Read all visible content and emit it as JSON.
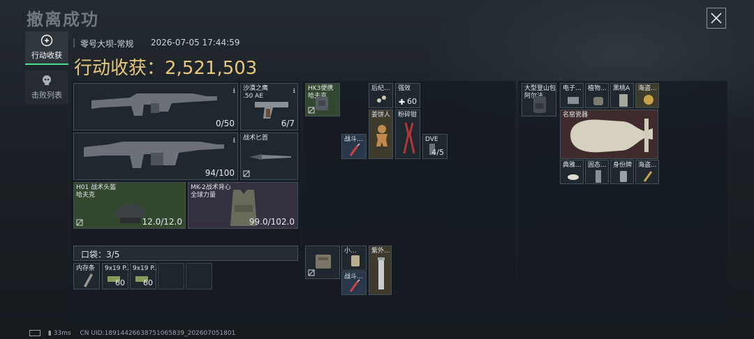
{
  "title": "撤离成功",
  "tabs": [
    {
      "label": "行动收获"
    },
    {
      "label": "击败列表"
    }
  ],
  "map_info": "零号大坝-常规",
  "timestamp": "2026-07-05 17:44:59",
  "haul": {
    "label": "行动收获：",
    "value": "2,521,503"
  },
  "gear": {
    "gun1": {
      "count": "0/50"
    },
    "pistol": {
      "name": "沙漠之鹰",
      "sub": ".50 AE",
      "count": "6/7"
    },
    "gun2": {
      "count": "94/100"
    },
    "knife": {
      "name": "战术匕首"
    },
    "helmet": {
      "name": "H01 战术头盔",
      "sub": "哈夫克",
      "durability": "12.0/12.0"
    },
    "vest": {
      "name": "MK-2战术背心",
      "sub": "全球力量",
      "durability": "99.0/102.0"
    }
  },
  "pocket": {
    "label": "口袋：",
    "value": "3/5"
  },
  "pocket_items": [
    {
      "name": "内存条",
      "count": ""
    },
    {
      "name": "9x19 P...",
      "count": "60"
    },
    {
      "name": "9x19 P...",
      "count": "60"
    }
  ],
  "mid_items": {
    "backpack": {
      "name": "HK3便携",
      "sub": "哈夫克"
    },
    "item_a": {
      "name": "后纪..."
    },
    "item_b": {
      "name": "强效",
      "count": "60"
    },
    "item_c": {
      "name": "战斗..."
    },
    "item_d": {
      "name": "姜饼人"
    },
    "item_e": {
      "name": "粉碎钳"
    },
    "item_f": {
      "name": "DVE",
      "count": "4/5"
    },
    "rig": {
      "name": ""
    },
    "item_g": {
      "name": "小..."
    },
    "item_h": {
      "name": "紫外..."
    },
    "item_i": {
      "name": "战斗..."
    }
  },
  "right_items": {
    "bag": {
      "name": "大型登山包",
      "sub": "阿尔法"
    },
    "r1": {
      "name": "电子..."
    },
    "r2": {
      "name": "植物..."
    },
    "r3": {
      "name": "黑桃A"
    },
    "r4": {
      "name": "海盗..."
    },
    "vase": {
      "name": "名窑瓷器"
    },
    "r5": {
      "name": "典雅..."
    },
    "r6": {
      "name": "固态..."
    },
    "r7": {
      "name": "身份牌"
    },
    "r8": {
      "name": "海盗..."
    }
  },
  "status": {
    "ping": "33ms",
    "uid": "CN UID:18914426638751065839_202607051801"
  }
}
